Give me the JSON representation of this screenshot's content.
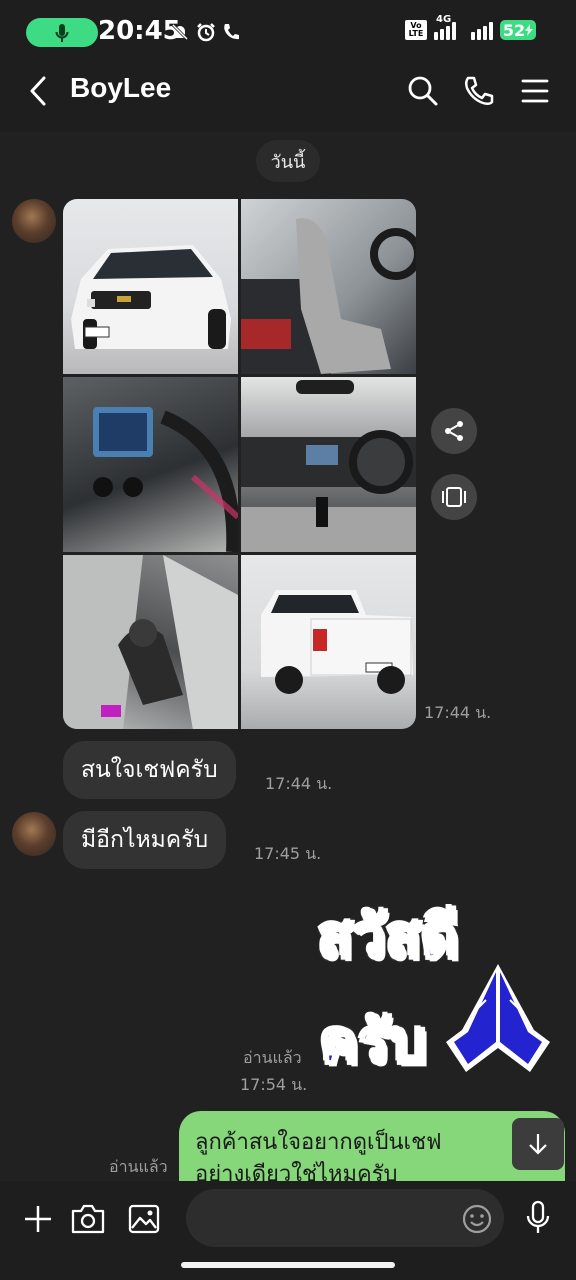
{
  "status_bar": {
    "time": "20:45",
    "network": "4G",
    "volte": "Vo LTE",
    "battery": "52"
  },
  "header": {
    "contact_name": "BoyLee"
  },
  "chat": {
    "date_label": "วันนี้",
    "photo_album": {
      "photo_count": 6,
      "time": "17:44 น."
    },
    "messages_in": [
      {
        "text": "สนใจเชฟครับ",
        "time": "17:44 น."
      },
      {
        "text": "มีอีกไหมครับ",
        "time": "17:45 น."
      }
    ],
    "sticker": {
      "line1": "สวัสดี",
      "line2": "ครับ",
      "read_label": "อ่านแล้ว",
      "time": "17:54 น."
    },
    "outgoing": {
      "line1": "ลูกค้าสนใจอยากดูเป็นเชฟ",
      "line2": "อย่างเดียวใช่ไหมครับ",
      "read_label": "อ่านแล้ว"
    }
  },
  "colors": {
    "background": "#212121",
    "bubble_in": "#333333",
    "bubble_out": "#86d67a",
    "accent_green": "#3ddc84",
    "sticker_blue": "#2222cc"
  }
}
